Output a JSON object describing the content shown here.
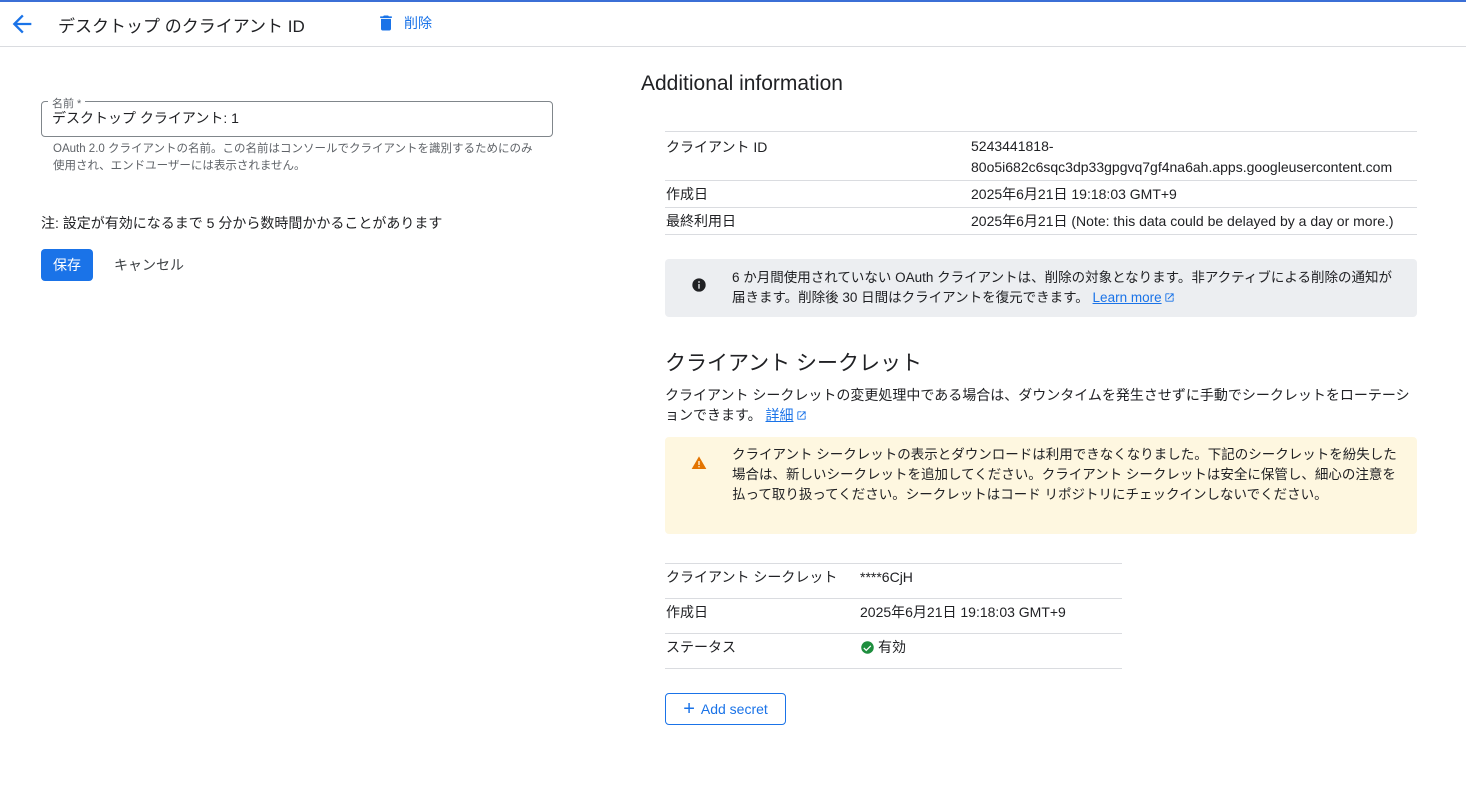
{
  "header": {
    "title": "デスクトップ のクライアント ID",
    "delete_label": "削除"
  },
  "form": {
    "name_label": "名前 *",
    "name_value": "デスクトップ クライアント: 1",
    "name_help": "OAuth 2.0 クライアントの名前。この名前はコンソールでクライアントを識別するためにのみ使用され、エンドユーザーには表示されません。",
    "note": "注: 設定が有効になるまで 5 分から数時間かかることがあります",
    "save_label": "保存",
    "cancel_label": "キャンセル"
  },
  "additional": {
    "title": "Additional information",
    "rows": [
      {
        "key": "クライアント ID",
        "value": "5243441818-80o5i682c6sqc3dp33gpgvq7gf4na6ah.apps.googleusercontent.com"
      },
      {
        "key": "作成日",
        "value": "2025年6月21日 19:18:03 GMT+9"
      },
      {
        "key": "最終利用日",
        "value": "2025年6月21日 (Note: this data could be delayed by a day or more.)"
      }
    ],
    "info_banner": "6 か月間使用されていない OAuth クライアントは、削除の対象となります。非アクティブによる削除の通知が届きます。削除後 30 日間はクライアントを復元できます。",
    "learn_more": "Learn more"
  },
  "secret": {
    "title": "クライアント シークレット",
    "desc": "クライアント シークレットの変更処理中である場合は、ダウンタイムを発生させずに手動でシークレットをローテーションできます。",
    "details_link": "詳細",
    "warning": "クライアント シークレットの表示とダウンロードは利用できなくなりました。下記のシークレットを紛失した場合は、新しいシークレットを追加してください。クライアント シークレットは安全に保管し、細心の注意を払って取り扱ってください。シークレットはコード リポジトリにチェックインしないでください。",
    "rows": [
      {
        "key": "クライアント シークレット",
        "value": "****6CjH"
      },
      {
        "key": "作成日",
        "value": "2025年6月21日 19:18:03 GMT+9"
      },
      {
        "key": "ステータス",
        "value": "有効"
      }
    ],
    "add_label": "Add secret"
  },
  "colors": {
    "accent": "#1a73e8",
    "success": "#1e8e3e",
    "warning": "#e37400"
  }
}
